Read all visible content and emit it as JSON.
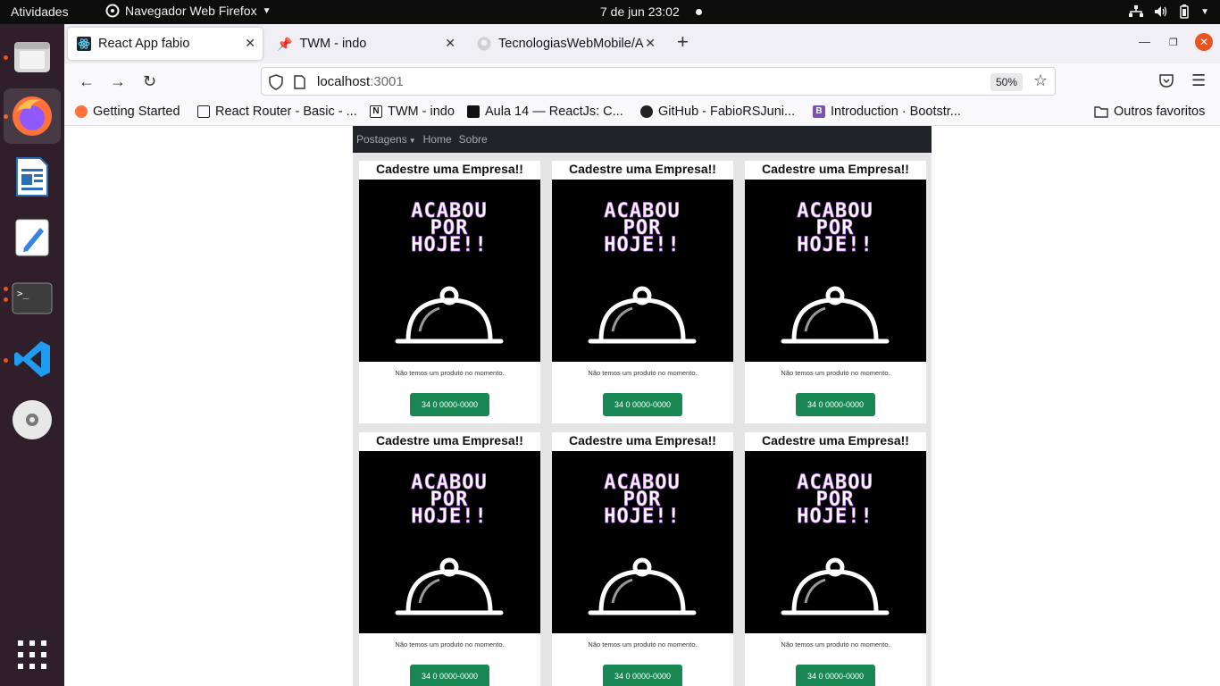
{
  "topbar": {
    "activities": "Atividades",
    "app_name": "Navegador Web Firefox",
    "clock": "7 de jun  23:02"
  },
  "dock": {
    "items": [
      "files-icon",
      "firefox-icon",
      "writer-icon",
      "text-editor-icon",
      "terminal-icon",
      "vscode-icon",
      "disc-icon",
      "app-grid-icon"
    ]
  },
  "browser": {
    "tabs": [
      {
        "title": "React App fabio",
        "icon": "react-icon",
        "active": true
      },
      {
        "title": "TWM - indo",
        "icon": "pin-icon",
        "active": false
      },
      {
        "title": "TecnologiasWebMobile/A",
        "icon": "github-icon",
        "active": false
      }
    ],
    "url_host": "localhost",
    "url_port": ":3001",
    "zoom": "50%",
    "bookmarks": [
      {
        "label": "Getting Started",
        "icon": "firefox-icon"
      },
      {
        "label": "React Router - Basic - ...",
        "icon": "page-icon"
      },
      {
        "label": "TWM - indo",
        "icon": "notion-icon"
      },
      {
        "label": "Aula 14 — ReactJs: C...",
        "icon": "bookmark-icon"
      },
      {
        "label": "GitHub - FabioRSJuni...",
        "icon": "github-icon"
      },
      {
        "label": "Introduction · Bootstr...",
        "icon": "bootstrap-icon"
      }
    ],
    "other_bookmarks": "Outros favoritos"
  },
  "app": {
    "nav": {
      "dropdown": "Postagens",
      "links": [
        "Home",
        "Sobre"
      ]
    },
    "cards": [
      {
        "title": "Cadestre uma Empresa!!",
        "image_text": [
          "ACABOU",
          "POR",
          "HOJE!!"
        ],
        "text": "Não temos um produto no momento.",
        "button": "34 0 0000-0000"
      },
      {
        "title": "Cadestre uma Empresa!!",
        "image_text": [
          "ACABOU",
          "POR",
          "HOJE!!"
        ],
        "text": "Não temos um produto no momento.",
        "button": "34 0 0000-0000"
      },
      {
        "title": "Cadestre uma Empresa!!",
        "image_text": [
          "ACABOU",
          "POR",
          "HOJE!!"
        ],
        "text": "Não temos um produto no momento.",
        "button": "34 0 0000-0000"
      },
      {
        "title": "Cadestre uma Empresa!!",
        "image_text": [
          "ACABOU",
          "POR",
          "HOJE!!"
        ],
        "text": "Não temos um produto no momento.",
        "button": "34 0 0000-0000"
      },
      {
        "title": "Cadestre uma Empresa!!",
        "image_text": [
          "ACABOU",
          "POR",
          "HOJE!!"
        ],
        "text": "Não temos um produto no momento.",
        "button": "34 0 0000-0000"
      },
      {
        "title": "Cadestre uma Empresa!!",
        "image_text": [
          "ACABOU",
          "POR",
          "HOJE!!"
        ],
        "text": "Não temos um produto no momento.",
        "button": "34 0 0000-0000"
      }
    ]
  },
  "colors": {
    "ubuntu_orange": "#e95420",
    "navbar_dark": "#212529",
    "button_green": "#198754"
  }
}
